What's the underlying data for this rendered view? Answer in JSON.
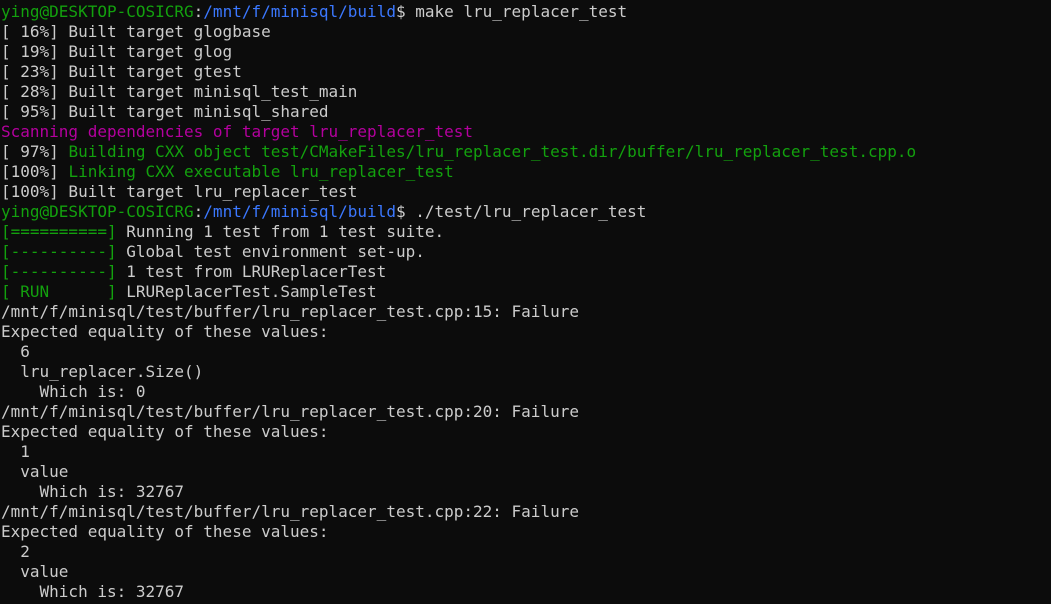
{
  "colors": {
    "background": "#0c0c0c",
    "default_text": "#cccccc",
    "prompt_user": "#13a10e",
    "prompt_path": "#3b78ff",
    "gtest_tag": "#13a10e",
    "cmake_build": "#13a10e",
    "cmake_scan": "#b4009e"
  },
  "terminal": {
    "lines": [
      {
        "segments": [
          {
            "text": "ying@DESKTOP-COSICRG",
            "color": "#13a10e"
          },
          {
            "text": ":",
            "color": "#cccccc"
          },
          {
            "text": "/mnt/f/minisql/build",
            "color": "#3b78ff"
          },
          {
            "text": "$ make lru_replacer_test",
            "color": "#cccccc"
          }
        ]
      },
      {
        "segments": [
          {
            "text": "[ 16%] Built target glogbase",
            "color": "#cccccc"
          }
        ]
      },
      {
        "segments": [
          {
            "text": "[ 19%] Built target glog",
            "color": "#cccccc"
          }
        ]
      },
      {
        "segments": [
          {
            "text": "[ 23%] Built target gtest",
            "color": "#cccccc"
          }
        ]
      },
      {
        "segments": [
          {
            "text": "[ 28%] Built target minisql_test_main",
            "color": "#cccccc"
          }
        ]
      },
      {
        "segments": [
          {
            "text": "[ 95%] Built target minisql_shared",
            "color": "#cccccc"
          }
        ]
      },
      {
        "segments": [
          {
            "text": "Scanning dependencies of target lru_replacer_test",
            "color": "#b4009e"
          }
        ]
      },
      {
        "segments": [
          {
            "text": "[ 97%] ",
            "color": "#cccccc"
          },
          {
            "text": "Building CXX object test/CMakeFiles/lru_replacer_test.dir/buffer/lru_replacer_test.cpp.o",
            "color": "#13a10e"
          }
        ]
      },
      {
        "segments": [
          {
            "text": "[100%] ",
            "color": "#cccccc"
          },
          {
            "text": "Linking CXX executable lru_replacer_test",
            "color": "#13a10e"
          }
        ]
      },
      {
        "segments": [
          {
            "text": "[100%] Built target lru_replacer_test",
            "color": "#cccccc"
          }
        ]
      },
      {
        "segments": [
          {
            "text": "ying@DESKTOP-COSICRG",
            "color": "#13a10e"
          },
          {
            "text": ":",
            "color": "#cccccc"
          },
          {
            "text": "/mnt/f/minisql/build",
            "color": "#3b78ff"
          },
          {
            "text": "$ ./test/lru_replacer_test",
            "color": "#cccccc"
          }
        ]
      },
      {
        "segments": [
          {
            "text": "[==========]",
            "color": "#13a10e"
          },
          {
            "text": " Running 1 test from 1 test suite.",
            "color": "#cccccc"
          }
        ]
      },
      {
        "segments": [
          {
            "text": "[----------]",
            "color": "#13a10e"
          },
          {
            "text": " Global test environment set-up.",
            "color": "#cccccc"
          }
        ]
      },
      {
        "segments": [
          {
            "text": "[----------]",
            "color": "#13a10e"
          },
          {
            "text": " 1 test from LRUReplacerTest",
            "color": "#cccccc"
          }
        ]
      },
      {
        "segments": [
          {
            "text": "[ RUN      ]",
            "color": "#13a10e"
          },
          {
            "text": " LRUReplacerTest.SampleTest",
            "color": "#cccccc"
          }
        ]
      },
      {
        "segments": [
          {
            "text": "/mnt/f/minisql/test/buffer/lru_replacer_test.cpp:15: Failure",
            "color": "#cccccc"
          }
        ]
      },
      {
        "segments": [
          {
            "text": "Expected equality of these values:",
            "color": "#cccccc"
          }
        ]
      },
      {
        "segments": [
          {
            "text": "  6",
            "color": "#cccccc"
          }
        ]
      },
      {
        "segments": [
          {
            "text": "  lru_replacer.Size()",
            "color": "#cccccc"
          }
        ]
      },
      {
        "segments": [
          {
            "text": "    Which is: 0",
            "color": "#cccccc"
          }
        ]
      },
      {
        "segments": [
          {
            "text": "/mnt/f/minisql/test/buffer/lru_replacer_test.cpp:20: Failure",
            "color": "#cccccc"
          }
        ]
      },
      {
        "segments": [
          {
            "text": "Expected equality of these values:",
            "color": "#cccccc"
          }
        ]
      },
      {
        "segments": [
          {
            "text": "  1",
            "color": "#cccccc"
          }
        ]
      },
      {
        "segments": [
          {
            "text": "  value",
            "color": "#cccccc"
          }
        ]
      },
      {
        "segments": [
          {
            "text": "    Which is: 32767",
            "color": "#cccccc"
          }
        ]
      },
      {
        "segments": [
          {
            "text": "/mnt/f/minisql/test/buffer/lru_replacer_test.cpp:22: Failure",
            "color": "#cccccc"
          }
        ]
      },
      {
        "segments": [
          {
            "text": "Expected equality of these values:",
            "color": "#cccccc"
          }
        ]
      },
      {
        "segments": [
          {
            "text": "  2",
            "color": "#cccccc"
          }
        ]
      },
      {
        "segments": [
          {
            "text": "  value",
            "color": "#cccccc"
          }
        ]
      },
      {
        "segments": [
          {
            "text": "    Which is: 32767",
            "color": "#cccccc"
          }
        ]
      }
    ]
  }
}
